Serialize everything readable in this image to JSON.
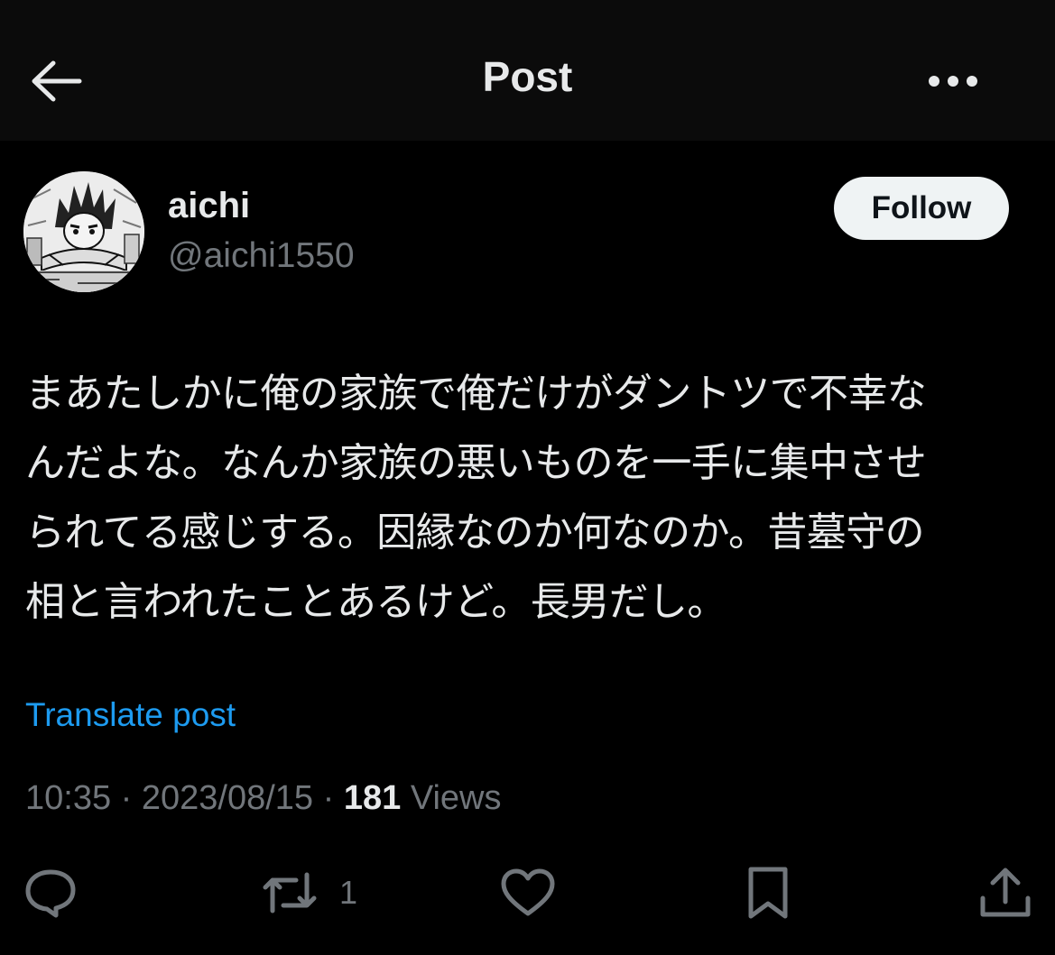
{
  "header": {
    "title": "Post",
    "back_icon": "arrow-left-icon",
    "more_icon": "more-horizontal-icon"
  },
  "author": {
    "display_name": "aichi",
    "handle": "@aichi1550",
    "follow_label": "Follow"
  },
  "post": {
    "text": "まあたしかに俺の家族で俺だけがダントツで不幸なんだよな。なんか家族の悪いものを一手に集中させられてる感じする。因縁なのか何なのか。昔墓守の相と言われたことあるけど。長男だし。",
    "text_lines": [
      "まあたしかに俺の家族で俺だけがダントツで不幸な",
      "んだよな。なんか家族の悪いものを一手に集中させ",
      "られてる感じする。因縁なのか何なのか。昔墓守の",
      "相と言われたことあるけど。長男だし。"
    ],
    "translate_label": "Translate post"
  },
  "meta": {
    "time": "10:35",
    "separator": "·",
    "date": "2023/08/15",
    "views_count": "181",
    "views_label": "Views"
  },
  "actions": {
    "reply_icon": "reply-icon",
    "repost_icon": "repost-icon",
    "repost_count": "1",
    "like_icon": "heart-icon",
    "bookmark_icon": "bookmark-icon",
    "share_icon": "share-icon"
  },
  "colors": {
    "background": "#000000",
    "header_background": "#0b0b0b",
    "primary_text": "#e7e9ea",
    "secondary_text": "#71767b",
    "link": "#1d9bf0",
    "follow_button_bg": "#eff3f4",
    "follow_button_text": "#0f1419"
  }
}
